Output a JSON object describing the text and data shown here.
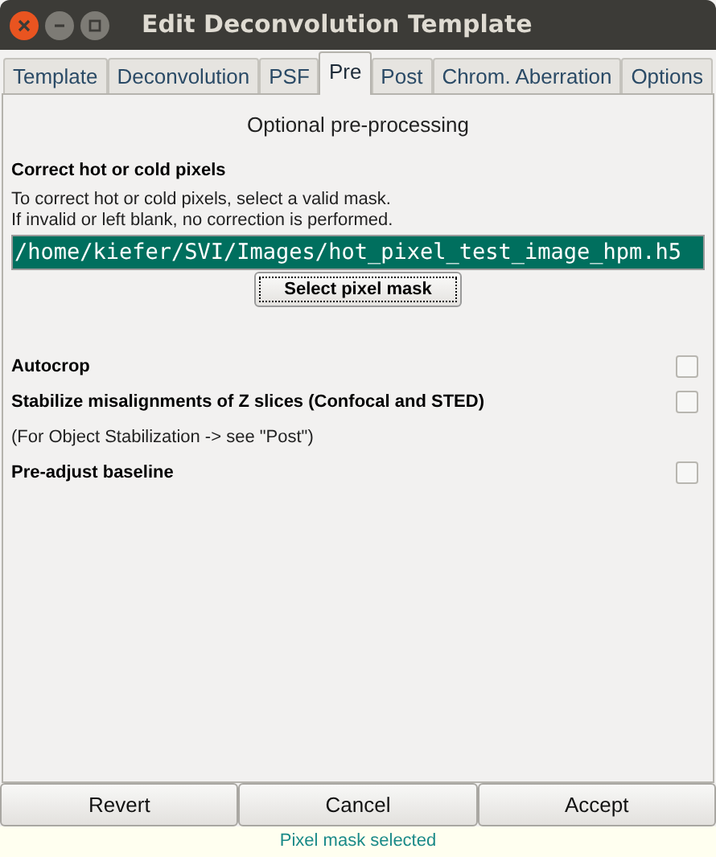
{
  "window": {
    "title": "Edit Deconvolution Template"
  },
  "tabs": [
    {
      "label": "Template",
      "selected": false
    },
    {
      "label": "Deconvolution",
      "selected": false
    },
    {
      "label": "PSF",
      "selected": false
    },
    {
      "label": "Pre",
      "selected": true
    },
    {
      "label": "Post",
      "selected": false
    },
    {
      "label": "Chrom. Aberration",
      "selected": false
    },
    {
      "label": "Options",
      "selected": false
    }
  ],
  "panel": {
    "heading": "Optional pre-processing",
    "section_title": "Correct hot or cold pixels",
    "description": [
      "To correct hot or cold pixels, select a valid mask.",
      "If invalid or left blank, no correction is performed."
    ],
    "mask_path": "/home/kiefer/SVI/Images/hot_pixel_test_image_hpm.h5",
    "select_button": "Select pixel mask",
    "options": [
      {
        "kind": "checkbox",
        "label": "Autocrop",
        "checked": false
      },
      {
        "kind": "checkbox",
        "label": "Stabilize misalignments of Z slices (Confocal and STED)",
        "checked": false
      },
      {
        "kind": "note",
        "label": "(For Object Stabilization -> see \"Post\")"
      },
      {
        "kind": "checkbox",
        "label": "Pre-adjust baseline",
        "checked": false
      }
    ]
  },
  "buttons": [
    "Revert",
    "Cancel",
    "Accept"
  ],
  "status_bar": "Pixel mask selected"
}
